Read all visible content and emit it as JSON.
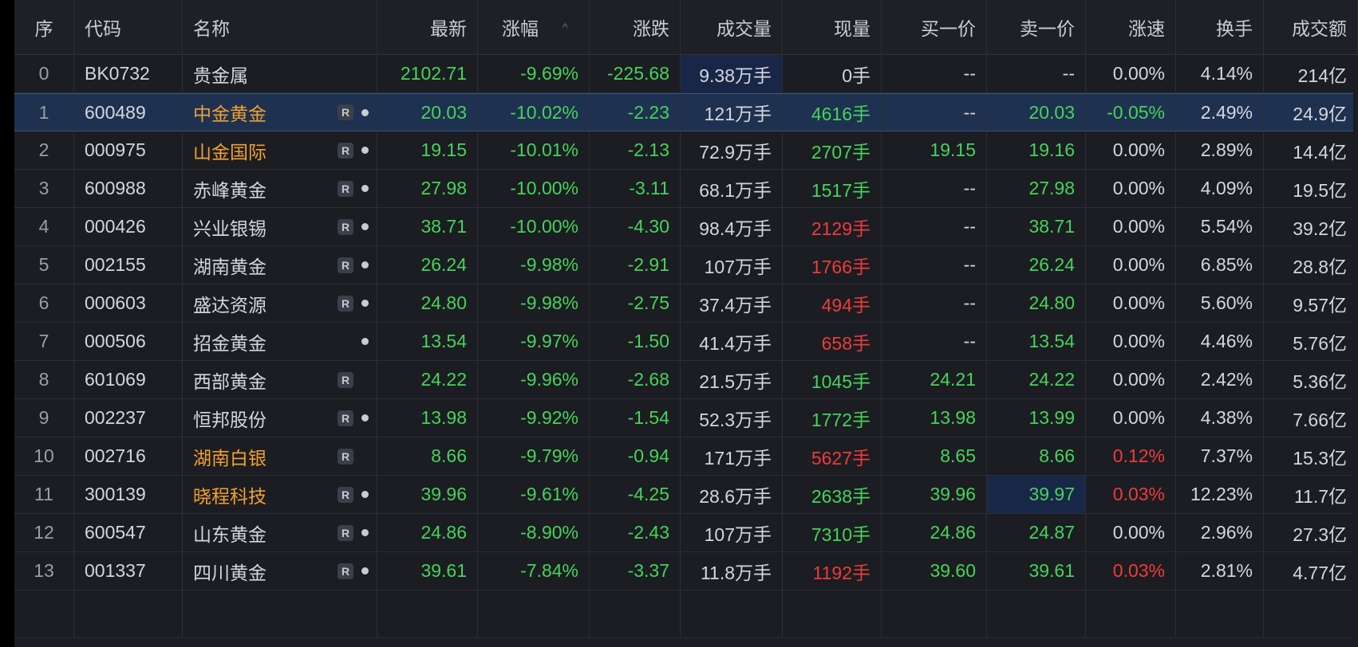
{
  "table": {
    "sort_indicator": "^",
    "columns": {
      "seq": "序",
      "code": "代码",
      "name": "名称",
      "last": "最新",
      "pct": "涨幅",
      "chg": "涨跌",
      "vol": "成交量",
      "now": "现量",
      "bid": "买一价",
      "ask": "卖一价",
      "speed": "涨速",
      "turn": "换手",
      "amt": "成交额"
    },
    "colors": {
      "up": "#ee3b3b",
      "down": "#46d35a",
      "flat": "#d4d6db",
      "highlight_name": "#f0a030",
      "selected_row": "#1f3150"
    },
    "rows": [
      {
        "seq": "0",
        "code": "BK0732",
        "name": "贵金属",
        "last": "2102.71",
        "pct": "-9.69%",
        "chg": "-225.68",
        "vol": "9.38万手",
        "now": "0手",
        "bid": "--",
        "ask": "--",
        "speed": "0.00%",
        "turn": "4.14%",
        "amt": "214亿"
      },
      {
        "seq": "1",
        "code": "600489",
        "name": "中金黄金",
        "last": "20.03",
        "pct": "-10.02%",
        "chg": "-2.23",
        "vol": "121万手",
        "now": "4616手",
        "bid": "--",
        "ask": "20.03",
        "speed": "-0.05%",
        "turn": "2.49%",
        "amt": "24.9亿"
      },
      {
        "seq": "2",
        "code": "000975",
        "name": "山金国际",
        "last": "19.15",
        "pct": "-10.01%",
        "chg": "-2.13",
        "vol": "72.9万手",
        "now": "2707手",
        "bid": "19.15",
        "ask": "19.16",
        "speed": "0.00%",
        "turn": "2.89%",
        "amt": "14.4亿"
      },
      {
        "seq": "3",
        "code": "600988",
        "name": "赤峰黄金",
        "last": "27.98",
        "pct": "-10.00%",
        "chg": "-3.11",
        "vol": "68.1万手",
        "now": "1517手",
        "bid": "--",
        "ask": "27.98",
        "speed": "0.00%",
        "turn": "4.09%",
        "amt": "19.5亿"
      },
      {
        "seq": "4",
        "code": "000426",
        "name": "兴业银锡",
        "last": "38.71",
        "pct": "-10.00%",
        "chg": "-4.30",
        "vol": "98.4万手",
        "now": "2129手",
        "bid": "--",
        "ask": "38.71",
        "speed": "0.00%",
        "turn": "5.54%",
        "amt": "39.2亿"
      },
      {
        "seq": "5",
        "code": "002155",
        "name": "湖南黄金",
        "last": "26.24",
        "pct": "-9.98%",
        "chg": "-2.91",
        "vol": "107万手",
        "now": "1766手",
        "bid": "--",
        "ask": "26.24",
        "speed": "0.00%",
        "turn": "6.85%",
        "amt": "28.8亿"
      },
      {
        "seq": "6",
        "code": "000603",
        "name": "盛达资源",
        "last": "24.80",
        "pct": "-9.98%",
        "chg": "-2.75",
        "vol": "37.4万手",
        "now": "494手",
        "bid": "--",
        "ask": "24.80",
        "speed": "0.00%",
        "turn": "5.60%",
        "amt": "9.57亿"
      },
      {
        "seq": "7",
        "code": "000506",
        "name": "招金黄金",
        "last": "13.54",
        "pct": "-9.97%",
        "chg": "-1.50",
        "vol": "41.4万手",
        "now": "658手",
        "bid": "--",
        "ask": "13.54",
        "speed": "0.00%",
        "turn": "4.46%",
        "amt": "5.76亿"
      },
      {
        "seq": "8",
        "code": "601069",
        "name": "西部黄金",
        "last": "24.22",
        "pct": "-9.96%",
        "chg": "-2.68",
        "vol": "21.5万手",
        "now": "1045手",
        "bid": "24.21",
        "ask": "24.22",
        "speed": "0.00%",
        "turn": "2.42%",
        "amt": "5.36亿"
      },
      {
        "seq": "9",
        "code": "002237",
        "name": "恒邦股份",
        "last": "13.98",
        "pct": "-9.92%",
        "chg": "-1.54",
        "vol": "52.3万手",
        "now": "1772手",
        "bid": "13.98",
        "ask": "13.99",
        "speed": "0.00%",
        "turn": "4.38%",
        "amt": "7.66亿"
      },
      {
        "seq": "10",
        "code": "002716",
        "name": "湖南白银",
        "last": "8.66",
        "pct": "-9.79%",
        "chg": "-0.94",
        "vol": "171万手",
        "now": "5627手",
        "bid": "8.65",
        "ask": "8.66",
        "speed": "0.12%",
        "turn": "7.37%",
        "amt": "15.3亿"
      },
      {
        "seq": "11",
        "code": "300139",
        "name": "晓程科技",
        "last": "39.96",
        "pct": "-9.61%",
        "chg": "-4.25",
        "vol": "28.6万手",
        "now": "2638手",
        "bid": "39.96",
        "ask": "39.97",
        "speed": "0.03%",
        "turn": "12.23%",
        "amt": "11.7亿"
      },
      {
        "seq": "12",
        "code": "600547",
        "name": "山东黄金",
        "last": "24.86",
        "pct": "-8.90%",
        "chg": "-2.43",
        "vol": "107万手",
        "now": "7310手",
        "bid": "24.86",
        "ask": "24.87",
        "speed": "0.00%",
        "turn": "2.96%",
        "amt": "27.3亿"
      },
      {
        "seq": "13",
        "code": "001337",
        "name": "四川黄金",
        "last": "39.61",
        "pct": "-7.84%",
        "chg": "-3.37",
        "vol": "11.8万手",
        "now": "1192手",
        "bid": "39.60",
        "ask": "39.61",
        "speed": "0.03%",
        "turn": "2.81%",
        "amt": "4.77亿"
      }
    ]
  }
}
